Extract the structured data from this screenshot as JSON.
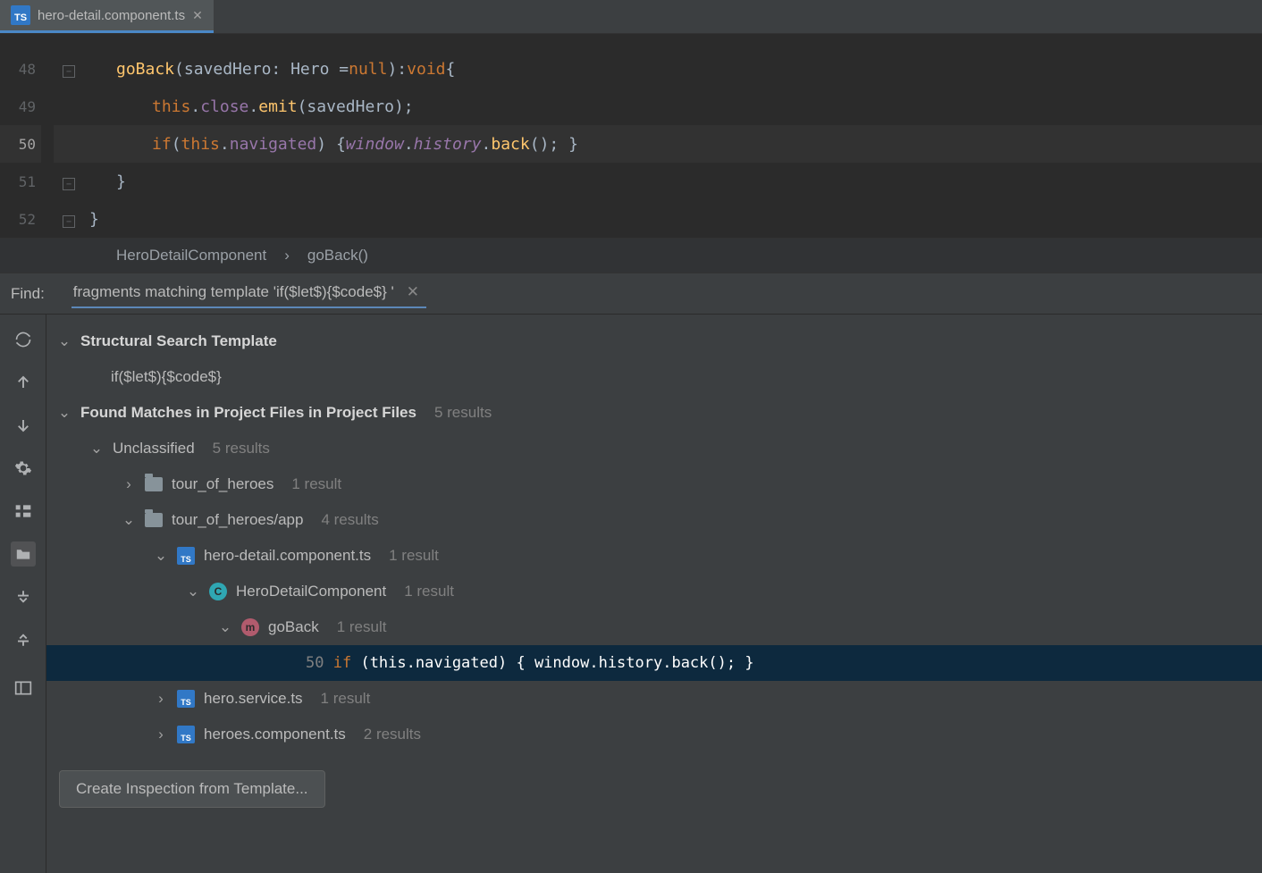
{
  "tab": {
    "filename": "hero-detail.component.ts"
  },
  "editor": {
    "lines": [
      {
        "n": "48"
      },
      {
        "n": "49"
      },
      {
        "n": "50"
      },
      {
        "n": "51"
      },
      {
        "n": "52"
      }
    ],
    "l48": {
      "fn": "goBack",
      "p1": "(savedHero: Hero = ",
      "null": "null",
      "p2": "): ",
      "void": "void",
      "brace": " {"
    },
    "l49": {
      "this": "this",
      "d1": ".",
      "close": "close",
      "d2": ".",
      "emit": "emit",
      "rest": "(savedHero);"
    },
    "l50": {
      "if": "if",
      "p1": " (",
      "this": "this",
      "d": ".",
      "nav": "navigated",
      "p2": ") { ",
      "win": "window",
      "d2": ".",
      "hist": "history",
      "d3": ".",
      "back": "back",
      "rest": "(); }"
    },
    "l51": {
      "brace": "}"
    },
    "l52": {
      "brace": "}"
    }
  },
  "breadcrumb": {
    "a": "HeroDetailComponent",
    "b": "goBack()"
  },
  "find": {
    "label": "Find:",
    "query": "fragments matching template 'if($let$){$code$} '"
  },
  "tree": {
    "template_header": "Structural Search Template",
    "template_body": "if($let$){$code$}",
    "found_header": "Found Matches in Project Files in Project Files",
    "found_count": "5 results",
    "group": "Unclassified",
    "group_count": "5 results",
    "folder1": "tour_of_heroes",
    "folder1_count": "1 result",
    "folder2": "tour_of_heroes/app",
    "folder2_count": "4 results",
    "file1": "hero-detail.component.ts",
    "file1_count": "1 result",
    "class1": "HeroDetailComponent",
    "class1_count": "1 result",
    "method1": "goBack",
    "method1_count": "1 result",
    "match_line_no": "50",
    "match_if": "if",
    "match_rest1": " (this.",
    "match_nav": "navigated",
    "match_rest2": ") { window.history.back(); }",
    "file2": "hero.service.ts",
    "file2_count": "1 result",
    "file3": "heroes.component.ts",
    "file3_count": "2 results"
  },
  "button": {
    "create": "Create Inspection from Template..."
  }
}
